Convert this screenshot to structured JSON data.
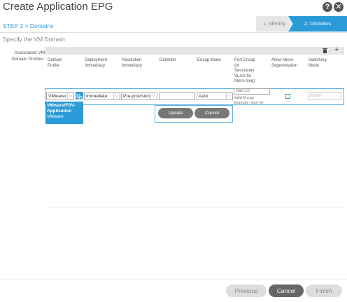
{
  "dialog": {
    "title": "Create Application EPG",
    "help": "?",
    "close": "✕"
  },
  "wizard": {
    "steps": [
      {
        "label": "1. Identity",
        "active": false
      },
      {
        "label": "2. Domains",
        "active": true
      }
    ],
    "step_label": "STEP 2 > Domains",
    "subtitle": "Specify the VM Domain"
  },
  "form": {
    "label_line1": "Associated VM",
    "label_line2": "Domain Profiles:"
  },
  "table": {
    "columns": [
      {
        "l1": "Domain",
        "l2": "Profile",
        "l3": "",
        "l4": "",
        "l5": ""
      },
      {
        "l1": "Deployment",
        "l2": "Immediacy",
        "l3": "",
        "l4": "",
        "l5": ""
      },
      {
        "l1": "Resolution",
        "l2": "Immediacy",
        "l3": "",
        "l4": "",
        "l5": ""
      },
      {
        "l1": "Delimiter",
        "l2": "",
        "l3": "",
        "l4": "",
        "l5": ""
      },
      {
        "l1": "Encap Mode",
        "l2": "",
        "l3": "",
        "l4": "",
        "l5": ""
      },
      {
        "l1": "Port Encap",
        "l2": "(or",
        "l3": "Secondary",
        "l4": "VLAN for",
        "l5": "Micro-Seg)"
      },
      {
        "l1": "Allow Micro-",
        "l2": "Segmentation",
        "l3": "",
        "l4": "",
        "l5": ""
      },
      {
        "l1": "Switching",
        "l2": "Mode",
        "l3": "",
        "l4": "",
        "l5": ""
      }
    ],
    "row": {
      "domain_profile": "VMware/",
      "deployment": "Immediate",
      "resolution": "Pre-provision",
      "delimiter": "",
      "encap_mode": "Auto",
      "port_encap": "vlan-10",
      "encap_hint1": "Valid Encap",
      "encap_hint2": "Example: vlan-10",
      "switching_mode_placeholder": "native"
    },
    "dropdown": {
      "line1": "VMware/FSV-",
      "line2": "Application",
      "line3": "VMware"
    },
    "update_label": "Update",
    "cancel_label": "Cancel"
  },
  "footer": {
    "previous": "Previous",
    "cancel": "Cancel",
    "finish": "Finish"
  },
  "colors": {
    "accent": "#2b9bd8",
    "button_dark": "#666666",
    "button_disabled": "#dddddd"
  }
}
